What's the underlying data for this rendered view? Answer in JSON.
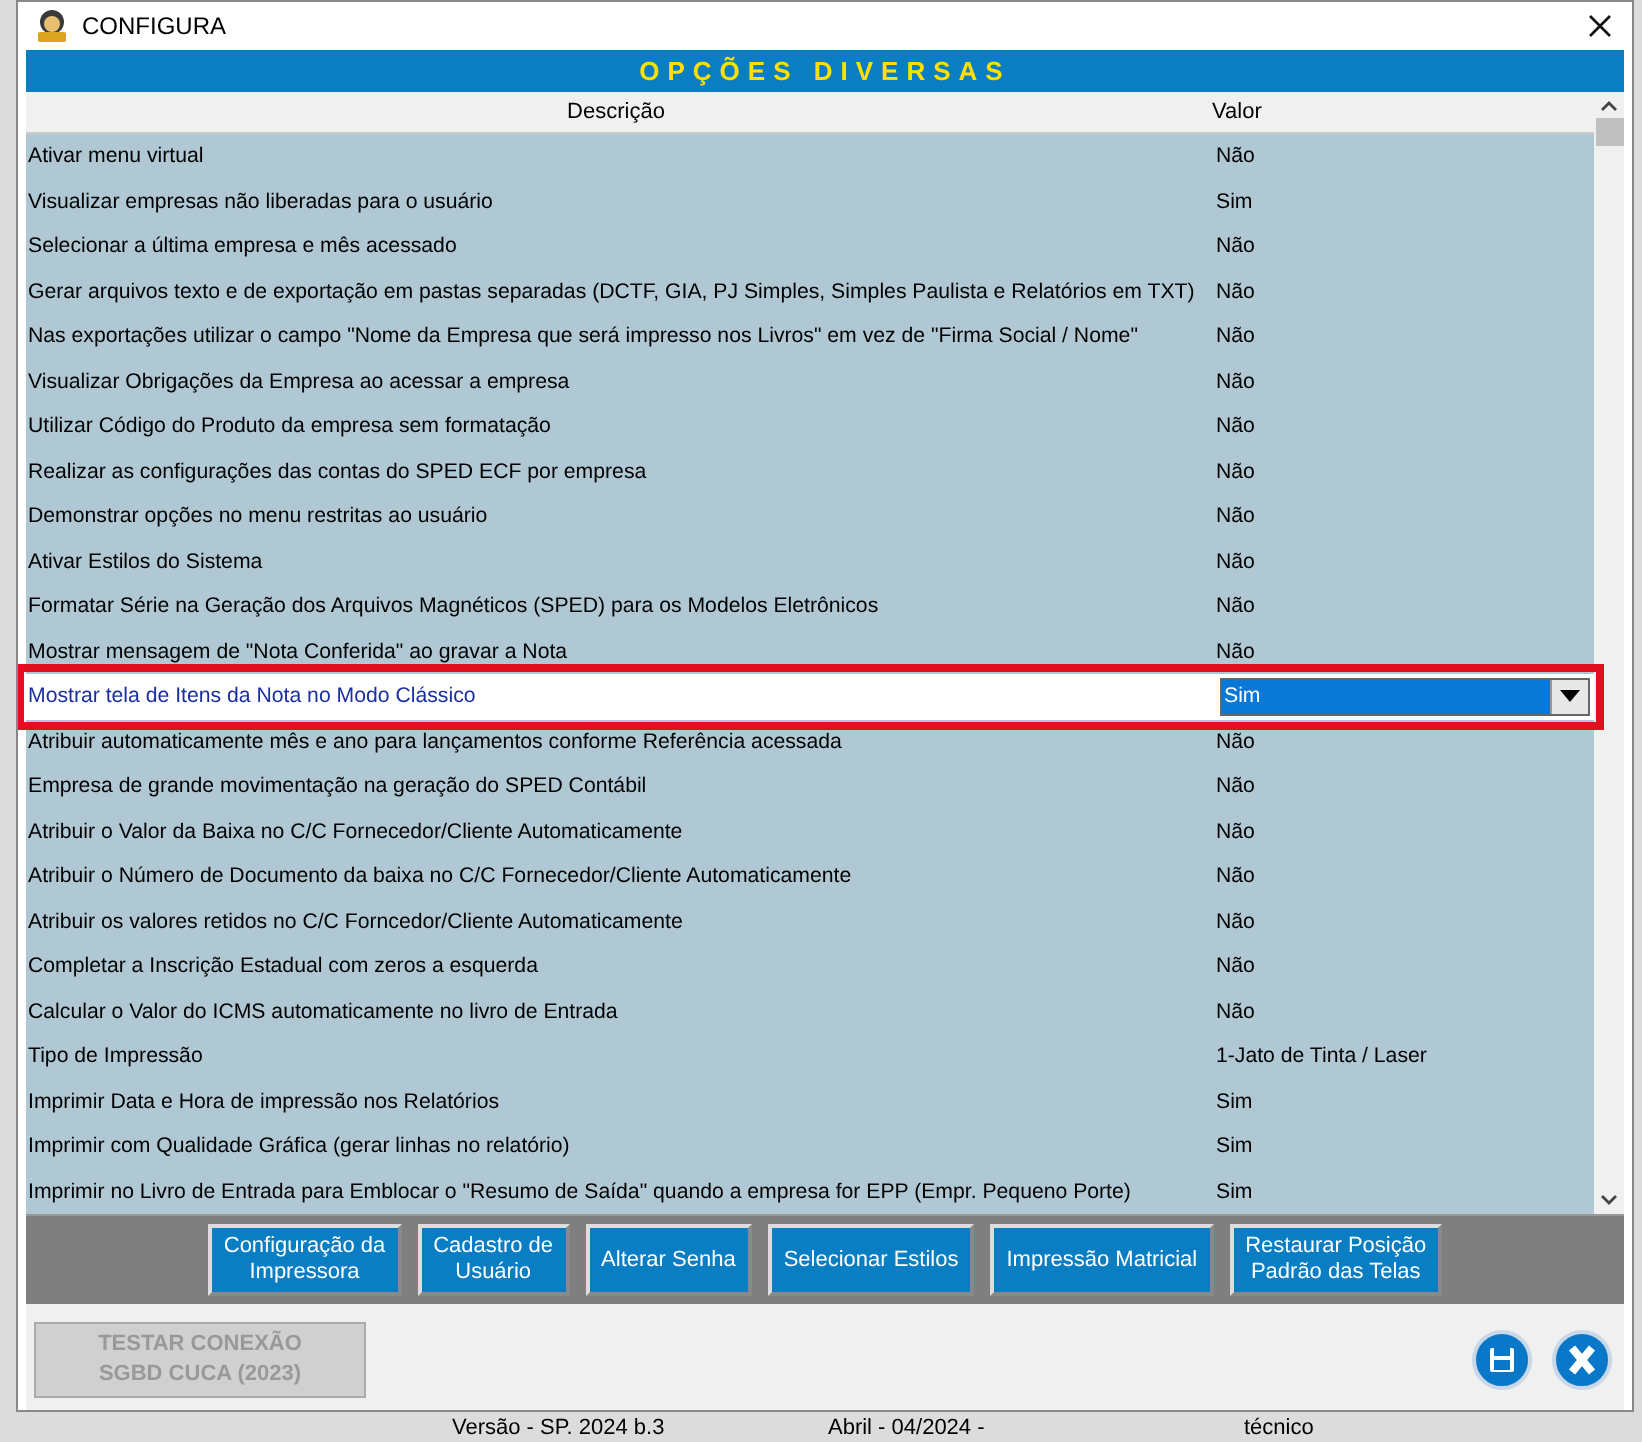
{
  "window": {
    "title": "CONFIGURA"
  },
  "banner": "OPÇÕES DIVERSAS",
  "table": {
    "columns": [
      "Descrição",
      "Valor"
    ],
    "rows": [
      {
        "description": "Ativar menu virtual",
        "value": "Não",
        "selected": false
      },
      {
        "description": "Visualizar empresas não liberadas para o usuário",
        "value": "Sim",
        "selected": false
      },
      {
        "description": "Selecionar a última empresa e mês acessado",
        "value": "Não",
        "selected": false
      },
      {
        "description": "Gerar arquivos texto e de exportação em pastas separadas (DCTF, GIA, PJ Simples, Simples Paulista e Relatórios em TXT)",
        "value": "Não",
        "selected": false
      },
      {
        "description": "Nas exportações utilizar o campo \"Nome da Empresa que será impresso nos Livros\" em vez de \"Firma Social / Nome\"",
        "value": "Não",
        "selected": false
      },
      {
        "description": "Visualizar Obrigações da Empresa ao acessar a empresa",
        "value": "Não",
        "selected": false
      },
      {
        "description": "Utilizar Código do Produto da empresa sem formatação",
        "value": "Não",
        "selected": false
      },
      {
        "description": "Realizar as configurações das contas do SPED ECF por empresa",
        "value": "Não",
        "selected": false
      },
      {
        "description": "Demonstrar opções no menu restritas ao usuário",
        "value": "Não",
        "selected": false
      },
      {
        "description": "Ativar Estilos do Sistema",
        "value": "Não",
        "selected": false
      },
      {
        "description": "Formatar Série na Geração dos Arquivos Magnéticos (SPED) para os Modelos Eletrônicos",
        "value": "Não",
        "selected": false
      },
      {
        "description": "Mostrar mensagem de \"Nota Conferida\" ao gravar a Nota",
        "value": "Não",
        "selected": false
      },
      {
        "description": "Mostrar tela de Itens da Nota no Modo Clássico",
        "value": "Sim",
        "selected": true
      },
      {
        "description": "Atribuir automaticamente mês e ano para lançamentos conforme Referência acessada",
        "value": "Não",
        "selected": false
      },
      {
        "description": "Empresa de grande movimentação na geração do SPED Contábil",
        "value": "Não",
        "selected": false
      },
      {
        "description": "Atribuir o Valor da Baixa no C/C Fornecedor/Cliente Automaticamente",
        "value": "Não",
        "selected": false
      },
      {
        "description": "Atribuir o Número de Documento da baixa no C/C Fornecedor/Cliente Automaticamente",
        "value": "Não",
        "selected": false
      },
      {
        "description": "Atribuir os valores retidos no C/C Forncedor/Cliente Automaticamente",
        "value": "Não",
        "selected": false
      },
      {
        "description": "Completar a Inscrição Estadual com zeros a esquerda",
        "value": "Não",
        "selected": false
      },
      {
        "description": "Calcular o Valor do ICMS automaticamente no livro de Entrada",
        "value": "Não",
        "selected": false
      },
      {
        "description": "Tipo de Impressão",
        "value": "1-Jato de Tinta / Laser",
        "selected": false
      },
      {
        "description": "Imprimir Data e Hora de impressão nos Relatórios",
        "value": "Sim",
        "selected": false
      },
      {
        "description": "Imprimir com Qualidade Gráfica (gerar linhas no relatório)",
        "value": "Sim",
        "selected": false
      },
      {
        "description": "Imprimir no Livro de Entrada para Emblocar o \"Resumo de Saída\" quando a empresa for EPP (Empr. Pequeno Porte)",
        "value": "Sim",
        "selected": false
      }
    ]
  },
  "buttons": [
    {
      "lines": [
        "Configuração da",
        "Impressora"
      ]
    },
    {
      "lines": [
        "Cadastro de",
        "Usuário"
      ]
    },
    {
      "lines": [
        "Alterar Senha"
      ]
    },
    {
      "lines": [
        "Selecionar Estilos"
      ]
    },
    {
      "lines": [
        "Impressão Matricial"
      ]
    },
    {
      "lines": [
        "Restaurar Posição",
        "Padrão das Telas"
      ]
    }
  ],
  "test_button": {
    "lines": [
      "TESTAR CONEXÃO",
      "SGBD CUCA (2023)"
    ],
    "disabled": true
  },
  "status_bar": [
    "Versão - SP. 2024 b.3",
    "Abril - 04/2024 -",
    "técnico"
  ]
}
